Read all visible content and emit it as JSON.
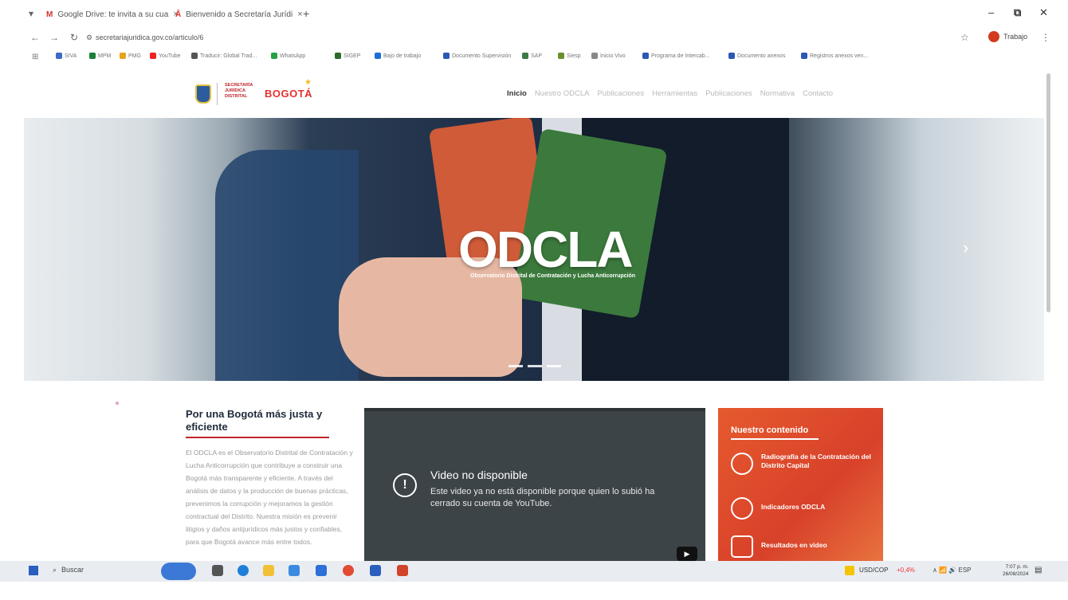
{
  "browser": {
    "tabs": [
      {
        "label": "Google Drive: te invita a su cua",
        "icon_color": "#d7322f"
      },
      {
        "label": "Bienvenido a Secretaría Jurídi",
        "icon_color": "#e4302f"
      }
    ],
    "new_tab": "+",
    "url": "secretariajuridica.gov.co/articulo/6",
    "profile_label": "Trabajo",
    "bookmarks": [
      "SIVA",
      "MPM",
      "PMG",
      "YouTube",
      "Traducir: Global Trad...",
      "WhatsApp",
      "SIGEP",
      "Bajo de trabajo",
      "Documento Supervisión",
      "SAP",
      "Siesp",
      "Inicio Vivo",
      "Programa de Intercab...",
      "Documento anexos",
      "Registros anexos ven..."
    ],
    "bookmark_colors": [
      "#3b6bc5",
      "#1a7f37",
      "#e6a317",
      "#e22",
      "#555",
      "#25a244",
      "#2b6b2b",
      "#1d6fd8",
      "#2b58b5",
      "#3b7a4a",
      "#6a8f2c",
      "#888",
      "#2b58b5",
      "#2b58b5",
      "#2b58b5"
    ]
  },
  "header": {
    "logo_secretaria": "SECRETARÍA JURÍDICA DISTRITAL",
    "logo_bogota": "BOGOTÁ",
    "nav": [
      "Inicio",
      "Nuestro ODCLA",
      "Publicaciones",
      "Herramientas",
      "Publicaciones",
      "Normativa",
      "Contacto"
    ]
  },
  "hero": {
    "logo_text": "ODCLA",
    "subtitle": "Observatorio Distrital de Contratación y Lucha Anticorrupción",
    "next_icon": "chevron-right-icon"
  },
  "intro": {
    "title": "Por una Bogotá más justa y eficiente",
    "body": "El ODCLA es el Observatorio Distrital de Contratación y Lucha Anticorrupción que contribuye a construir una Bogotá más transparente y eficiente. A través del análisis de datos y la producción de buenas prácticas, prevenimos la corrupción y mejoramos la gestión contractual del Distrito. Nuestra misión es prevenir litigios y daños antijurídicos más justos y confiables, para que Bogotá avance más entre todos."
  },
  "video": {
    "title": "Video no disponible",
    "message": "Este video ya no está disponible porque quien lo subió ha cerrado su cuenta de YouTube."
  },
  "panel": {
    "title": "Nuestro contenido",
    "items": [
      "Radiografía de la Contratación del Distrito Capital",
      "Indicadores ODCLA",
      "Resultados en video"
    ]
  },
  "taskbar": {
    "search": "Buscar",
    "currency": "USD/COP",
    "currency_change": "+0,4%",
    "lang": "ESP",
    "time": "7:07 p. m.",
    "date": "26/08/2024"
  }
}
